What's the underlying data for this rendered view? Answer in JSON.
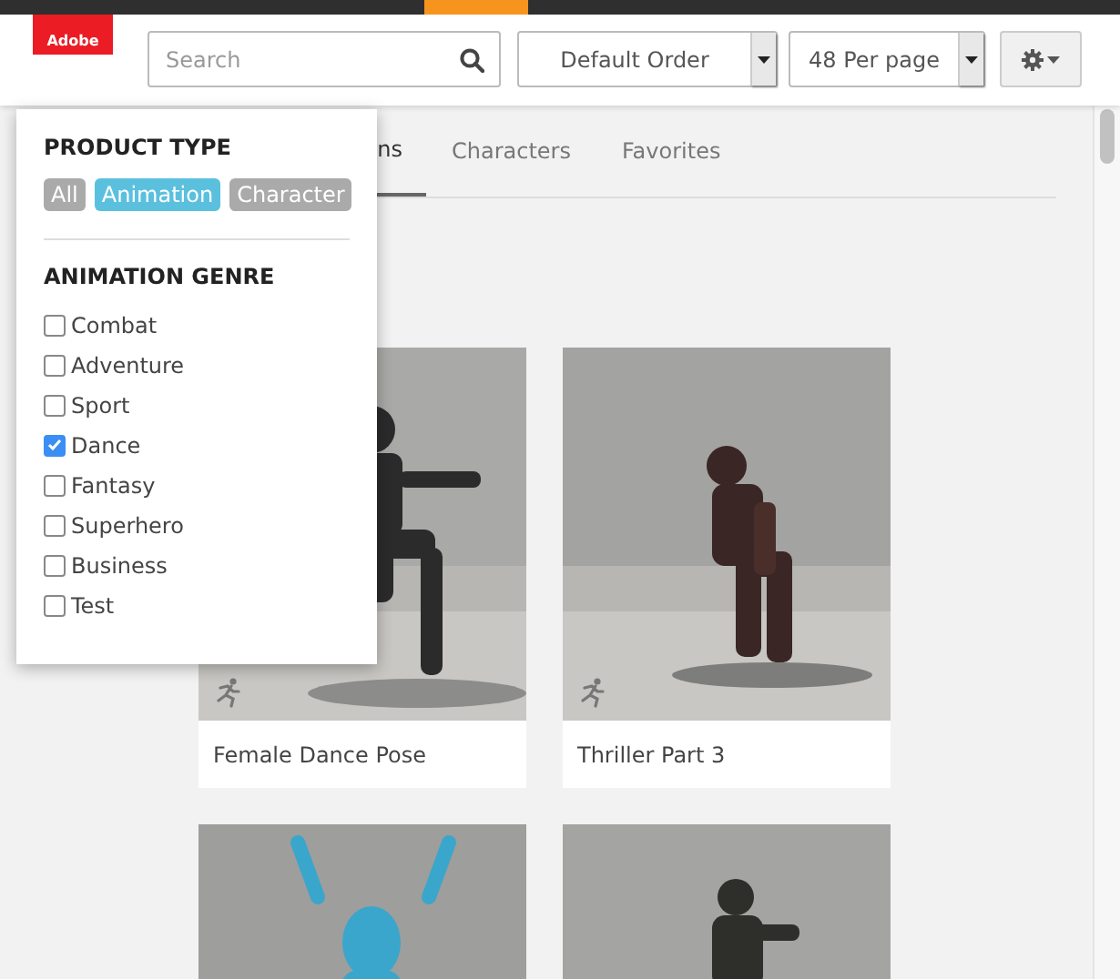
{
  "header": {
    "logo": "Adobe",
    "search": {
      "placeholder": "Search"
    },
    "sort": "Default Order",
    "per_page": "48 Per page"
  },
  "tabs": [
    {
      "label": "ns",
      "selected": true
    },
    {
      "label": "Characters",
      "selected": false
    },
    {
      "label": "Favorites",
      "selected": false
    }
  ],
  "filter": {
    "product_type": {
      "title": "PRODUCT TYPE",
      "options": [
        {
          "label": "All",
          "selected": false
        },
        {
          "label": "Animation",
          "selected": true
        },
        {
          "label": "Character",
          "selected": false
        }
      ]
    },
    "genre": {
      "title": "ANIMATION GENRE",
      "options": [
        {
          "label": "Combat",
          "checked": false
        },
        {
          "label": "Adventure",
          "checked": false
        },
        {
          "label": "Sport",
          "checked": false
        },
        {
          "label": "Dance",
          "checked": true
        },
        {
          "label": "Fantasy",
          "checked": false
        },
        {
          "label": "Superhero",
          "checked": false
        },
        {
          "label": "Business",
          "checked": false
        },
        {
          "label": "Test",
          "checked": false
        }
      ]
    }
  },
  "cards": [
    {
      "title": "Female Dance Pose",
      "kind": "picture",
      "animation_icon": true
    },
    {
      "title": "Thriller Part 3",
      "kind": "picture",
      "animation_icon": true
    },
    {
      "kind": "picture"
    },
    {
      "kind": "picture"
    }
  ]
}
